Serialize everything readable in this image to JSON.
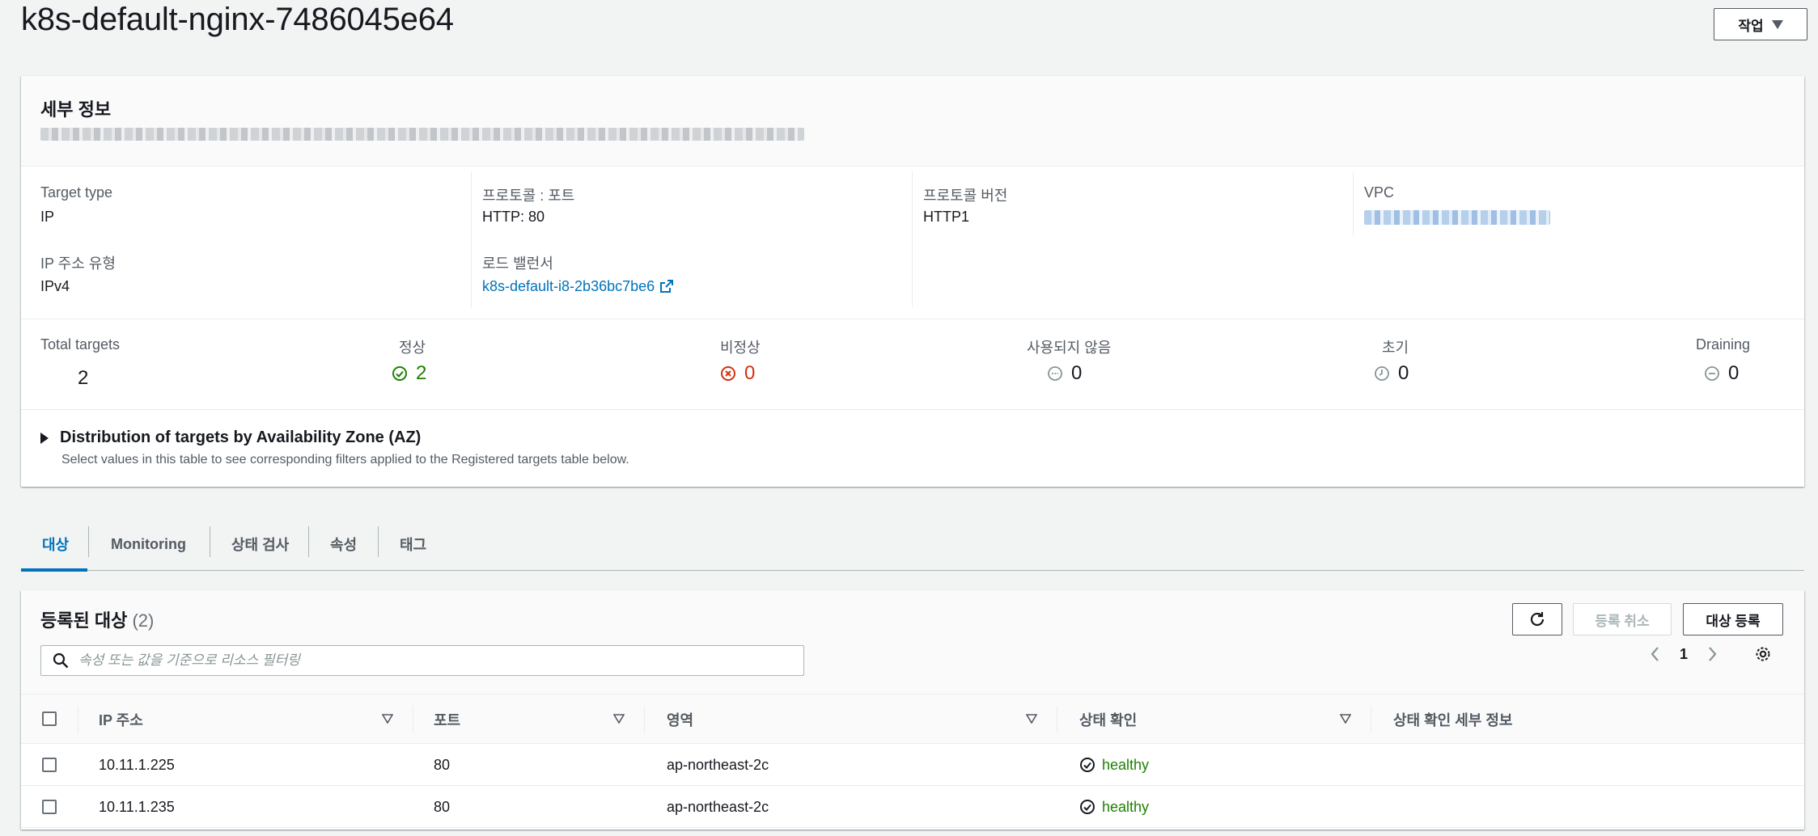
{
  "page": {
    "title": "k8s-default-nginx-7486045e64",
    "actions_label": "작업"
  },
  "details": {
    "title": "세부 정보",
    "fields": {
      "target_type": {
        "label": "Target type",
        "value": "IP"
      },
      "protocol_port": {
        "label": "프로토콜 : 포트",
        "value": "HTTP: 80"
      },
      "protocol_version": {
        "label": "프로토콜 버전",
        "value": "HTTP1"
      },
      "vpc": {
        "label": "VPC"
      },
      "ip_address_type": {
        "label": "IP 주소 유형",
        "value": "IPv4"
      },
      "load_balancer": {
        "label": "로드 밸런서",
        "value": "k8s-default-i8-2b36bc7be6"
      }
    },
    "stats": {
      "total": {
        "label": "Total targets",
        "value": "2"
      },
      "healthy": {
        "label": "정상",
        "value": "2"
      },
      "unhealthy": {
        "label": "비정상",
        "value": "0"
      },
      "unused": {
        "label": "사용되지 않음",
        "value": "0"
      },
      "initial": {
        "label": "초기",
        "value": "0"
      },
      "draining": {
        "label": "Draining",
        "value": "0"
      }
    },
    "az": {
      "title": "Distribution of targets by Availability Zone (AZ)",
      "description": "Select values in this table to see corresponding filters applied to the Registered targets table below."
    }
  },
  "tabs": [
    {
      "label": "대상",
      "active": true
    },
    {
      "label": "Monitoring"
    },
    {
      "label": "상태 검사"
    },
    {
      "label": "속성"
    },
    {
      "label": "태그"
    }
  ],
  "targets": {
    "title": "등록된 대상",
    "count": "(2)",
    "deregister_label": "등록 취소",
    "register_label": "대상 등록",
    "search_placeholder": "속성 또는 값을 기준으로 리소스 필터링",
    "page_number": "1",
    "columns": [
      "IP 주소",
      "포트",
      "영역",
      "상태 확인",
      "상태 확인 세부 정보"
    ],
    "rows": [
      {
        "ip": "10.11.1.225",
        "port": "80",
        "zone": "ap-northeast-2c",
        "health": "healthy",
        "details": ""
      },
      {
        "ip": "10.11.1.235",
        "port": "80",
        "zone": "ap-northeast-2c",
        "health": "healthy",
        "details": ""
      }
    ]
  },
  "colors": {
    "link": "#0073bb",
    "healthy": "#1d8102",
    "unhealthy": "#d13212",
    "muted": "#687078"
  },
  "icons": [
    "caret-down-icon",
    "external-link-icon",
    "check-circle-icon",
    "x-circle-icon",
    "minus-circle-icon",
    "clock-icon",
    "refresh-icon",
    "search-icon",
    "chevron-left-icon",
    "chevron-right-icon",
    "gear-icon",
    "sort-icon",
    "caret-right-icon"
  ]
}
